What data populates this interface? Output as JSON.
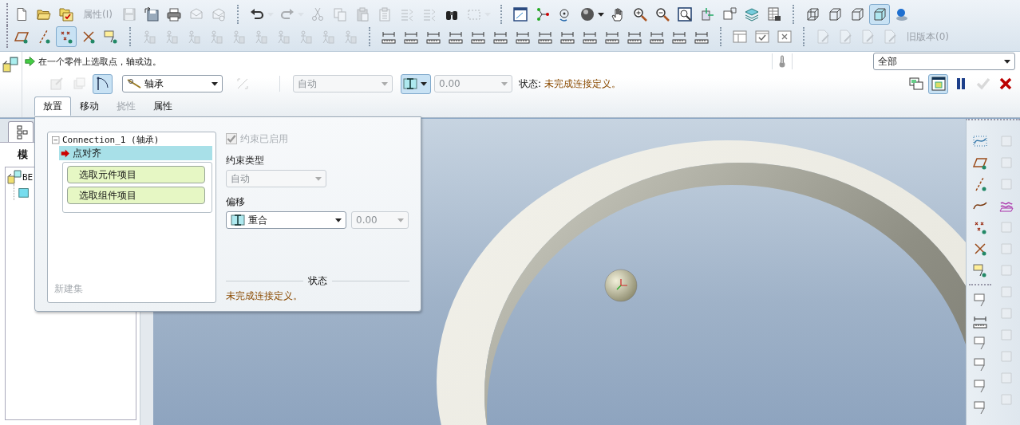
{
  "toolbar": {
    "row_1": [
      {
        "kind": "icon",
        "disabled": false,
        "pressed": false
      },
      {
        "kind": "icon",
        "disabled": false,
        "pressed": false
      },
      {
        "kind": "icon",
        "disabled": false,
        "pressed": false
      },
      {
        "kind": "label",
        "text": "属性(I)",
        "disabled": true
      },
      {
        "kind": "icon",
        "disabled": true,
        "pressed": false
      },
      {
        "kind": "icon",
        "disabled": false,
        "pressed": false
      },
      {
        "kind": "icon",
        "disabled": false,
        "pressed": false
      },
      {
        "kind": "icon",
        "disabled": true,
        "pressed": false
      },
      {
        "kind": "icon",
        "disabled": true,
        "pressed": false
      },
      {
        "kind": "separator"
      },
      {
        "kind": "icon",
        "disabled": false,
        "pressed": false
      },
      {
        "kind": "dropdown",
        "disabled": true
      },
      {
        "kind": "icon",
        "disabled": true,
        "pressed": false
      },
      {
        "kind": "dropdown",
        "disabled": true
      },
      {
        "kind": "icon",
        "disabled": true,
        "pressed": false
      },
      {
        "kind": "icon",
        "disabled": true,
        "pressed": false
      },
      {
        "kind": "icon",
        "disabled": true,
        "pressed": false
      },
      {
        "kind": "icon",
        "disabled": true,
        "pressed": false
      },
      {
        "kind": "icon",
        "disabled": true,
        "pressed": false
      },
      {
        "kind": "icon",
        "disabled": true,
        "pressed": false
      },
      {
        "kind": "icon",
        "disabled": false,
        "pressed": false
      },
      {
        "kind": "icon",
        "disabled": true,
        "pressed": false
      },
      {
        "kind": "dropdown",
        "disabled": true
      },
      {
        "kind": "separator"
      },
      {
        "kind": "icon",
        "disabled": false,
        "pressed": false
      },
      {
        "kind": "icon",
        "disabled": false,
        "pressed": false
      },
      {
        "kind": "icon",
        "disabled": false,
        "pressed": false
      },
      {
        "kind": "icon",
        "disabled": false,
        "pressed": false
      },
      {
        "kind": "dropdown",
        "disabled": false
      },
      {
        "kind": "icon",
        "disabled": false,
        "pressed": false
      },
      {
        "kind": "icon",
        "disabled": false,
        "pressed": false
      },
      {
        "kind": "icon",
        "disabled": false,
        "pressed": false
      },
      {
        "kind": "icon",
        "disabled": false,
        "pressed": false
      },
      {
        "kind": "icon",
        "disabled": false,
        "pressed": false
      },
      {
        "kind": "icon",
        "disabled": false,
        "pressed": false
      },
      {
        "kind": "icon",
        "disabled": false,
        "pressed": false
      },
      {
        "kind": "icon",
        "disabled": false,
        "pressed": false
      },
      {
        "kind": "separator"
      },
      {
        "kind": "icon",
        "disabled": false,
        "pressed": false
      },
      {
        "kind": "icon",
        "disabled": false,
        "pressed": false
      },
      {
        "kind": "icon",
        "disabled": false,
        "pressed": false
      },
      {
        "kind": "icon",
        "disabled": false,
        "pressed": true
      },
      {
        "kind": "icon",
        "disabled": false,
        "pressed": false
      }
    ],
    "row_2": [
      {
        "kind": "icon",
        "disabled": false,
        "pressed": false
      },
      {
        "kind": "icon",
        "disabled": false,
        "pressed": false
      },
      {
        "kind": "icon",
        "disabled": false,
        "pressed": true
      },
      {
        "kind": "icon",
        "disabled": false,
        "pressed": false
      },
      {
        "kind": "icon",
        "disabled": false,
        "pressed": false
      },
      {
        "kind": "separator"
      },
      {
        "kind": "icon",
        "disabled": true,
        "pressed": false
      },
      {
        "kind": "icon",
        "disabled": true,
        "pressed": false
      },
      {
        "kind": "icon",
        "disabled": true,
        "pressed": false
      },
      {
        "kind": "icon",
        "disabled": true,
        "pressed": false
      },
      {
        "kind": "icon",
        "disabled": true,
        "pressed": false
      },
      {
        "kind": "icon",
        "disabled": true,
        "pressed": false
      },
      {
        "kind": "icon",
        "disabled": true,
        "pressed": false
      },
      {
        "kind": "icon",
        "disabled": true,
        "pressed": false
      },
      {
        "kind": "icon",
        "disabled": true,
        "pressed": false
      },
      {
        "kind": "icon",
        "disabled": true,
        "pressed": false
      },
      {
        "kind": "separator"
      },
      {
        "kind": "icon",
        "disabled": false,
        "pressed": false
      },
      {
        "kind": "icon",
        "disabled": false,
        "pressed": false
      },
      {
        "kind": "icon",
        "disabled": false,
        "pressed": false
      },
      {
        "kind": "icon",
        "disabled": false,
        "pressed": false
      },
      {
        "kind": "icon",
        "disabled": false,
        "pressed": false
      },
      {
        "kind": "icon",
        "disabled": false,
        "pressed": false
      },
      {
        "kind": "icon",
        "disabled": false,
        "pressed": false
      },
      {
        "kind": "icon",
        "disabled": false,
        "pressed": false
      },
      {
        "kind": "icon",
        "disabled": false,
        "pressed": false
      },
      {
        "kind": "icon",
        "disabled": false,
        "pressed": false
      },
      {
        "kind": "icon",
        "disabled": false,
        "pressed": false
      },
      {
        "kind": "icon",
        "disabled": false,
        "pressed": false
      },
      {
        "kind": "icon",
        "disabled": false,
        "pressed": false
      },
      {
        "kind": "icon",
        "disabled": false,
        "pressed": false
      },
      {
        "kind": "icon",
        "disabled": false,
        "pressed": false
      },
      {
        "kind": "separator"
      },
      {
        "kind": "icon",
        "disabled": false,
        "pressed": false
      },
      {
        "kind": "icon",
        "disabled": false,
        "pressed": false
      },
      {
        "kind": "icon",
        "disabled": false,
        "pressed": false
      },
      {
        "kind": "separator"
      },
      {
        "kind": "icon",
        "disabled": true,
        "pressed": false
      },
      {
        "kind": "icon",
        "disabled": true,
        "pressed": false
      },
      {
        "kind": "icon",
        "disabled": true,
        "pressed": false
      },
      {
        "kind": "icon",
        "disabled": true,
        "pressed": false
      },
      {
        "kind": "label",
        "text": "旧版本(0)",
        "disabled": true
      }
    ]
  },
  "dashboard": {
    "prompt": "在一个零件上选取点，轴或边。",
    "filter": {
      "value": "全部"
    },
    "tool_buttons": [
      {
        "disabled": true,
        "pressed": false
      },
      {
        "disabled": true,
        "pressed": false
      },
      {
        "disabled": false,
        "pressed": true
      }
    ],
    "connection_type": {
      "value": "轴承"
    },
    "flip_button": {
      "disabled": true
    },
    "constraint_type": {
      "value": "自动",
      "disabled": true
    },
    "offset_type": {
      "pressed": true
    },
    "offset_value": {
      "value": "0.00",
      "disabled": true
    },
    "status_label": "状态:",
    "status": "未完成连接定义。",
    "actions": [
      {
        "disabled": false,
        "pressed": false
      },
      {
        "disabled": false,
        "pressed": true
      },
      {
        "disabled": false,
        "pressed": false
      },
      {
        "disabled": true,
        "pressed": false
      },
      {
        "disabled": false,
        "pressed": false
      }
    ],
    "tabs": [
      {
        "label": "放置",
        "selected": true,
        "disabled": false
      },
      {
        "label": "移动",
        "selected": false,
        "disabled": false
      },
      {
        "label": "挠性",
        "selected": false,
        "disabled": true
      },
      {
        "label": "属性",
        "selected": false,
        "disabled": false
      }
    ]
  },
  "model_tree": {
    "tabs": [
      {
        "selected": true
      }
    ],
    "title": "模",
    "items": [
      {
        "label": "BE",
        "kind": "assembly",
        "children": [
          {
            "kind": "part"
          }
        ]
      }
    ]
  },
  "placement_panel": {
    "tree": {
      "label": "Connection_1 (轴承)",
      "expanded": true,
      "children": [
        {
          "label": "点对齐",
          "selected": true,
          "collectors": [
            {
              "label": "选取元件项目"
            },
            {
              "label": "选取组件项目"
            }
          ]
        }
      ]
    },
    "new_set": {
      "label": "新建集",
      "disabled": true
    },
    "constraint_enabled": {
      "label": "约束已启用",
      "checked": true,
      "disabled": true
    },
    "constraint_type_label": "约束类型",
    "constraint_type": {
      "value": "自动",
      "disabled": true
    },
    "offset_label": "偏移",
    "offset": {
      "value": "重合"
    },
    "offset_value": {
      "value": "0.00",
      "disabled": true
    },
    "status_heading": "状态",
    "status": "未完成连接定义。"
  },
  "side_toolbar": {
    "column_1": [
      {
        "kind": "icon",
        "disabled": false
      },
      {
        "kind": "icon",
        "disabled": false
      },
      {
        "kind": "icon",
        "disabled": false
      },
      {
        "kind": "icon",
        "disabled": false
      },
      {
        "kind": "icon",
        "disabled": false
      },
      {
        "kind": "icon",
        "disabled": false
      },
      {
        "kind": "icon",
        "disabled": false
      },
      {
        "kind": "separator"
      },
      {
        "kind": "icon",
        "disabled": false
      },
      {
        "kind": "icon",
        "disabled": false
      },
      {
        "kind": "icon",
        "disabled": false
      },
      {
        "kind": "icon",
        "disabled": false
      },
      {
        "kind": "icon",
        "disabled": false
      },
      {
        "kind": "icon",
        "disabled": false
      }
    ],
    "column_2": [
      {
        "kind": "icon",
        "disabled": true
      },
      {
        "kind": "icon",
        "disabled": true
      },
      {
        "kind": "icon",
        "disabled": true
      },
      {
        "kind": "icon",
        "disabled": false
      },
      {
        "kind": "icon",
        "disabled": true
      },
      {
        "kind": "icon",
        "disabled": true
      },
      {
        "kind": "icon",
        "disabled": true
      },
      {
        "kind": "icon",
        "disabled": true
      },
      {
        "kind": "icon",
        "disabled": true
      },
      {
        "kind": "icon",
        "disabled": true
      },
      {
        "kind": "icon",
        "disabled": true
      },
      {
        "kind": "icon",
        "disabled": true
      },
      {
        "kind": "icon",
        "disabled": true
      }
    ]
  }
}
